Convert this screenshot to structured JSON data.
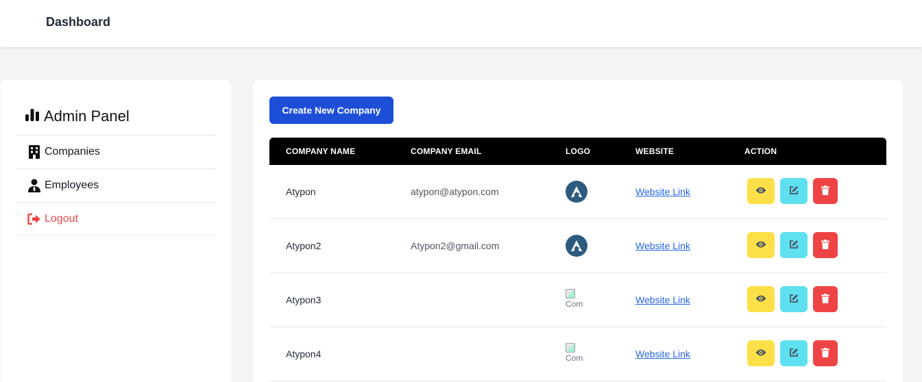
{
  "header": {
    "title": "Dashboard"
  },
  "sidebar": {
    "brand": "Admin Panel",
    "items": [
      {
        "label": "Companies",
        "icon": "building-icon"
      },
      {
        "label": "Employees",
        "icon": "user-tie-icon"
      },
      {
        "label": "Logout",
        "icon": "sign-out-icon"
      }
    ]
  },
  "main": {
    "create_label": "Create New Company",
    "table": {
      "headers": [
        "COMPANY NAME",
        "COMPANY EMAIL",
        "LOGO",
        "WEBSITE",
        "ACTION"
      ],
      "rows": [
        {
          "name": "Atypon",
          "email": "atypon@atypon.com",
          "logo": "atypon-logo",
          "website": "Website Link"
        },
        {
          "name": "Atypon2",
          "email": "Atypon2@gmail.com",
          "logo": "atypon-logo",
          "website": "Website Link"
        },
        {
          "name": "Atypon3",
          "email": "",
          "logo": "Com",
          "website": "Website Link"
        },
        {
          "name": "Atypon4",
          "email": "",
          "logo": "Com",
          "website": "Website Link"
        }
      ]
    }
  },
  "colors": {
    "primary": "#1d4ed8",
    "view": "#fde047",
    "edit": "#5ee0f0",
    "delete": "#ef4444",
    "logo_bg": "#2d5b80"
  }
}
